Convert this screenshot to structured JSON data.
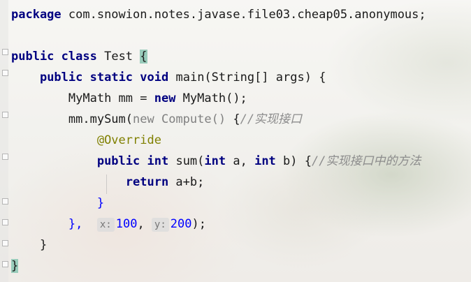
{
  "editor": {
    "line1": {
      "kw": "package",
      "pkg": " com.snowion.notes.javase.file03.cheap05.anonymous;"
    },
    "line3": {
      "kw1": "public",
      "kw2": "class",
      "name": " Test ",
      "brace": "{"
    },
    "line4": {
      "kw1": "public",
      "kw2": "static",
      "kw3": "void",
      "sig": " main(String[] args) ",
      "brace": "{"
    },
    "line5": {
      "type": "MyMath mm = ",
      "kw": "new",
      "rest": " MyMath();"
    },
    "line6": {
      "call": "mm.mySum(",
      "kw": "new",
      "anon": " Compute() ",
      "brace": "{",
      "comment": "//实现接口"
    },
    "line7": {
      "annotation": "@Override"
    },
    "line8": {
      "kw1": "public",
      "kw2": "int",
      "mid": " sum(",
      "kw3": "int",
      "a": " a, ",
      "kw4": "int",
      "b": " b) ",
      "brace": "{",
      "comment": "//实现接口中的方法"
    },
    "line9": {
      "kw": "return",
      "expr": " a+b;"
    },
    "line10": {
      "brace": "}"
    },
    "line11": {
      "close": "}, ",
      "hint_x": "x:",
      "val_x": "100",
      "comma": ", ",
      "hint_y": "y:",
      "val_y": "200",
      "end": ");"
    },
    "line12": {
      "brace": "}"
    },
    "line13": {
      "brace": "}"
    }
  }
}
